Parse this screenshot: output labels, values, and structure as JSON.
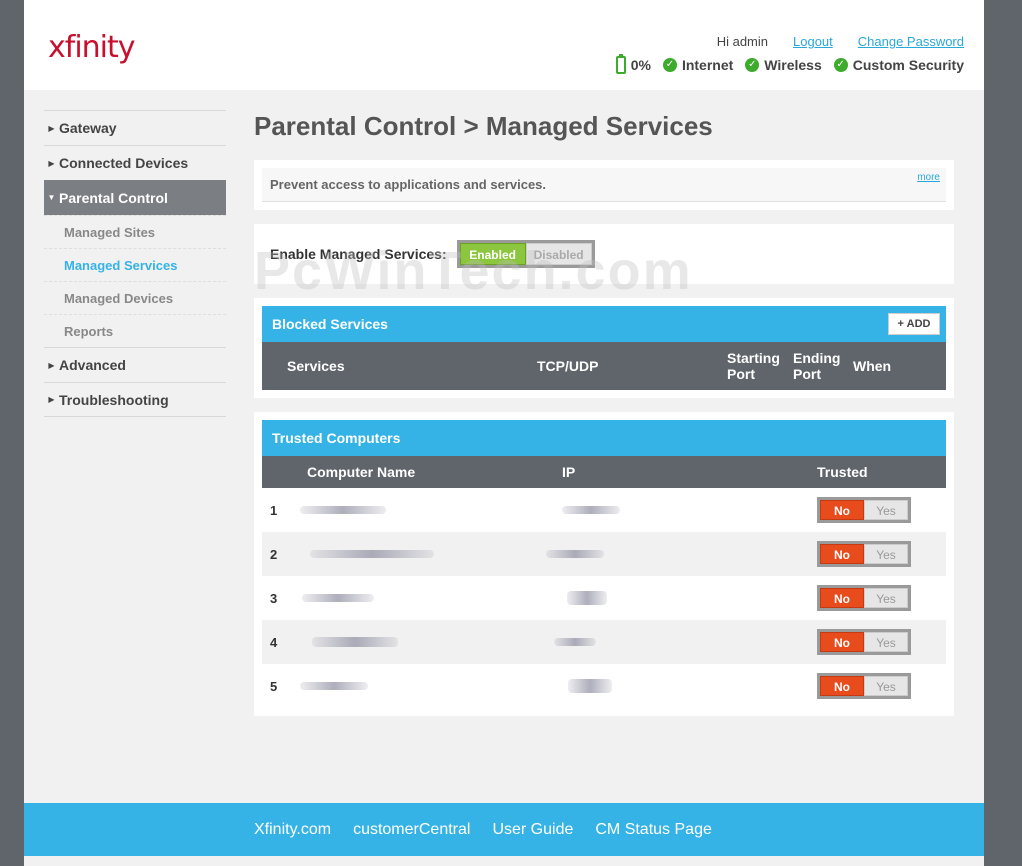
{
  "header": {
    "logo": "xfinity",
    "greeting": "Hi admin",
    "logout": "Logout",
    "change_password": "Change Password",
    "battery_percent": "0%",
    "status": [
      "Internet",
      "Wireless",
      "Custom Security"
    ]
  },
  "sidebar": {
    "items": [
      "Gateway",
      "Connected Devices",
      "Parental Control",
      "Advanced",
      "Troubleshooting"
    ],
    "sub_items": [
      "Managed Sites",
      "Managed Services",
      "Managed Devices",
      "Reports"
    ]
  },
  "main": {
    "title": "Parental Control > Managed Services",
    "intro": "Prevent access to applications and services.",
    "more": "more",
    "enable_label": "Enable Managed Services:",
    "enabled": "Enabled",
    "disabled": "Disabled",
    "watermark": "PcWinTech.com"
  },
  "blocked": {
    "title": "Blocked Services",
    "add": "+ ADD",
    "columns": [
      "Services",
      "TCP/UDP",
      "Starting Port",
      "Ending Port",
      "When"
    ]
  },
  "trusted": {
    "title": "Trusted Computers",
    "columns": [
      "Computer Name",
      "IP",
      "Trusted"
    ],
    "rows": [
      "1",
      "2",
      "3",
      "4",
      "5"
    ],
    "no": "No",
    "yes": "Yes"
  },
  "footer": {
    "links": [
      "Xfinity.com",
      "customerCentral",
      "User Guide",
      "CM Status Page"
    ]
  }
}
